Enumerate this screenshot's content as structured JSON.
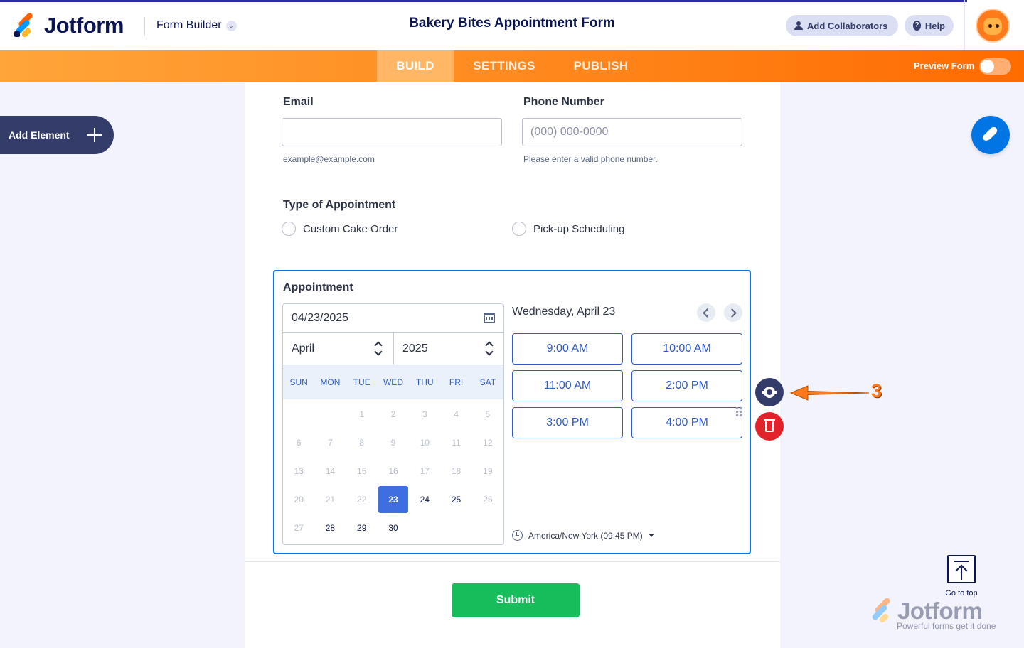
{
  "header": {
    "brand": "Jotform",
    "product_menu": "Form Builder",
    "form_title": "Bakery Bites Appointment Form",
    "add_collaborators": "Add Collaborators",
    "help": "Help"
  },
  "nav": {
    "tabs": [
      {
        "label": "BUILD",
        "active": true
      },
      {
        "label": "SETTINGS",
        "active": false
      },
      {
        "label": "PUBLISH",
        "active": false
      }
    ],
    "preview_label": "Preview Form",
    "preview_on": false
  },
  "sidebar": {
    "add_element": "Add Element"
  },
  "form": {
    "email": {
      "label": "Email",
      "value": "",
      "sublabel": "example@example.com"
    },
    "phone": {
      "label": "Phone Number",
      "placeholder": "(000) 000-0000",
      "sublabel": "Please enter a valid phone number."
    },
    "appointment_type": {
      "label": "Type of Appointment",
      "options": [
        "Custom Cake Order",
        "Pick-up Scheduling"
      ]
    },
    "appointment": {
      "label": "Appointment",
      "date_value": "04/23/2025",
      "month": "April",
      "year": "2025",
      "weekdays": [
        "SUN",
        "MON",
        "TUE",
        "WED",
        "THU",
        "FRI",
        "SAT"
      ],
      "first_weekday_index": 2,
      "days_in_month": 30,
      "available_days": [
        24,
        25,
        28,
        29,
        30
      ],
      "selected_day": 23,
      "selected_date_heading": "Wednesday, April 23",
      "time_slots": [
        "9:00 AM",
        "10:00 AM",
        "11:00 AM",
        "2:00 PM",
        "3:00 PM",
        "4:00 PM"
      ],
      "timezone": "America/New York (09:45 PM)"
    },
    "submit": "Submit"
  },
  "annotation": {
    "number": "3",
    "color": "#ff7a1a"
  },
  "footer": {
    "go_to_top": "Go to top",
    "watermark_brand": "Jotform",
    "watermark_tagline": "Powerful forms get it done"
  },
  "colors": {
    "accent_orange": "#ff6b00",
    "primary_blue": "#0075e3",
    "submit_green": "#18bd5b",
    "navy": "#0a1551",
    "danger": "#e3232c"
  }
}
